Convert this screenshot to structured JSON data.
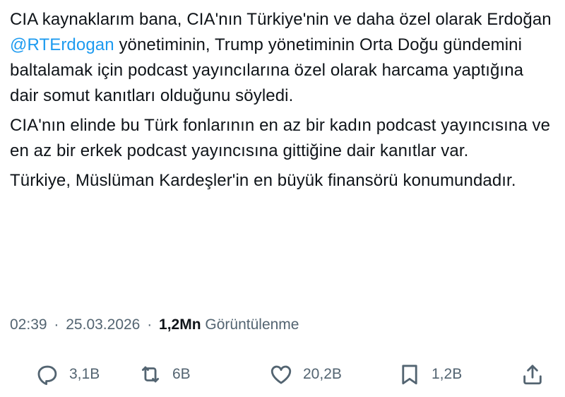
{
  "tweet": {
    "paragraph1_before": "CIA kaynaklarım bana, CIA'nın Türkiye'nin ve daha özel olarak Erdoğan ",
    "mention": "@RTErdogan",
    "paragraph1_after": " yönetiminin, Trump yönetiminin Orta Doğu gündemini baltalamak için podcast yayıncılarına özel olarak harcama yaptığına dair somut kanıtları olduğunu söyledi.",
    "paragraph2": "CIA'nın elinde bu Türk fonlarının en az bir kadın podcast yayıncısına ve en az bir erkek podcast yayıncısına gittiğine dair kanıtlar var.",
    "paragraph3": "Türkiye, Müslüman Kardeşler'in en büyük finansörü konumundadır."
  },
  "meta": {
    "time": "02:39",
    "separator": "·",
    "date": "25.03.2026",
    "views_count": "1,2Mn",
    "views_label": "Görüntülenme"
  },
  "actions": {
    "replies": {
      "icon": "reply-icon",
      "count": "3,1B"
    },
    "reposts": {
      "icon": "repost-icon",
      "count": "6B"
    },
    "likes": {
      "icon": "heart-icon",
      "count": "20,2B"
    },
    "bookmarks": {
      "icon": "bookmark-icon",
      "count": "1,2B"
    },
    "share": {
      "icon": "share-icon"
    }
  },
  "colors": {
    "text": "#0f1419",
    "secondary": "#536471",
    "mention": "#1d9bf0"
  }
}
